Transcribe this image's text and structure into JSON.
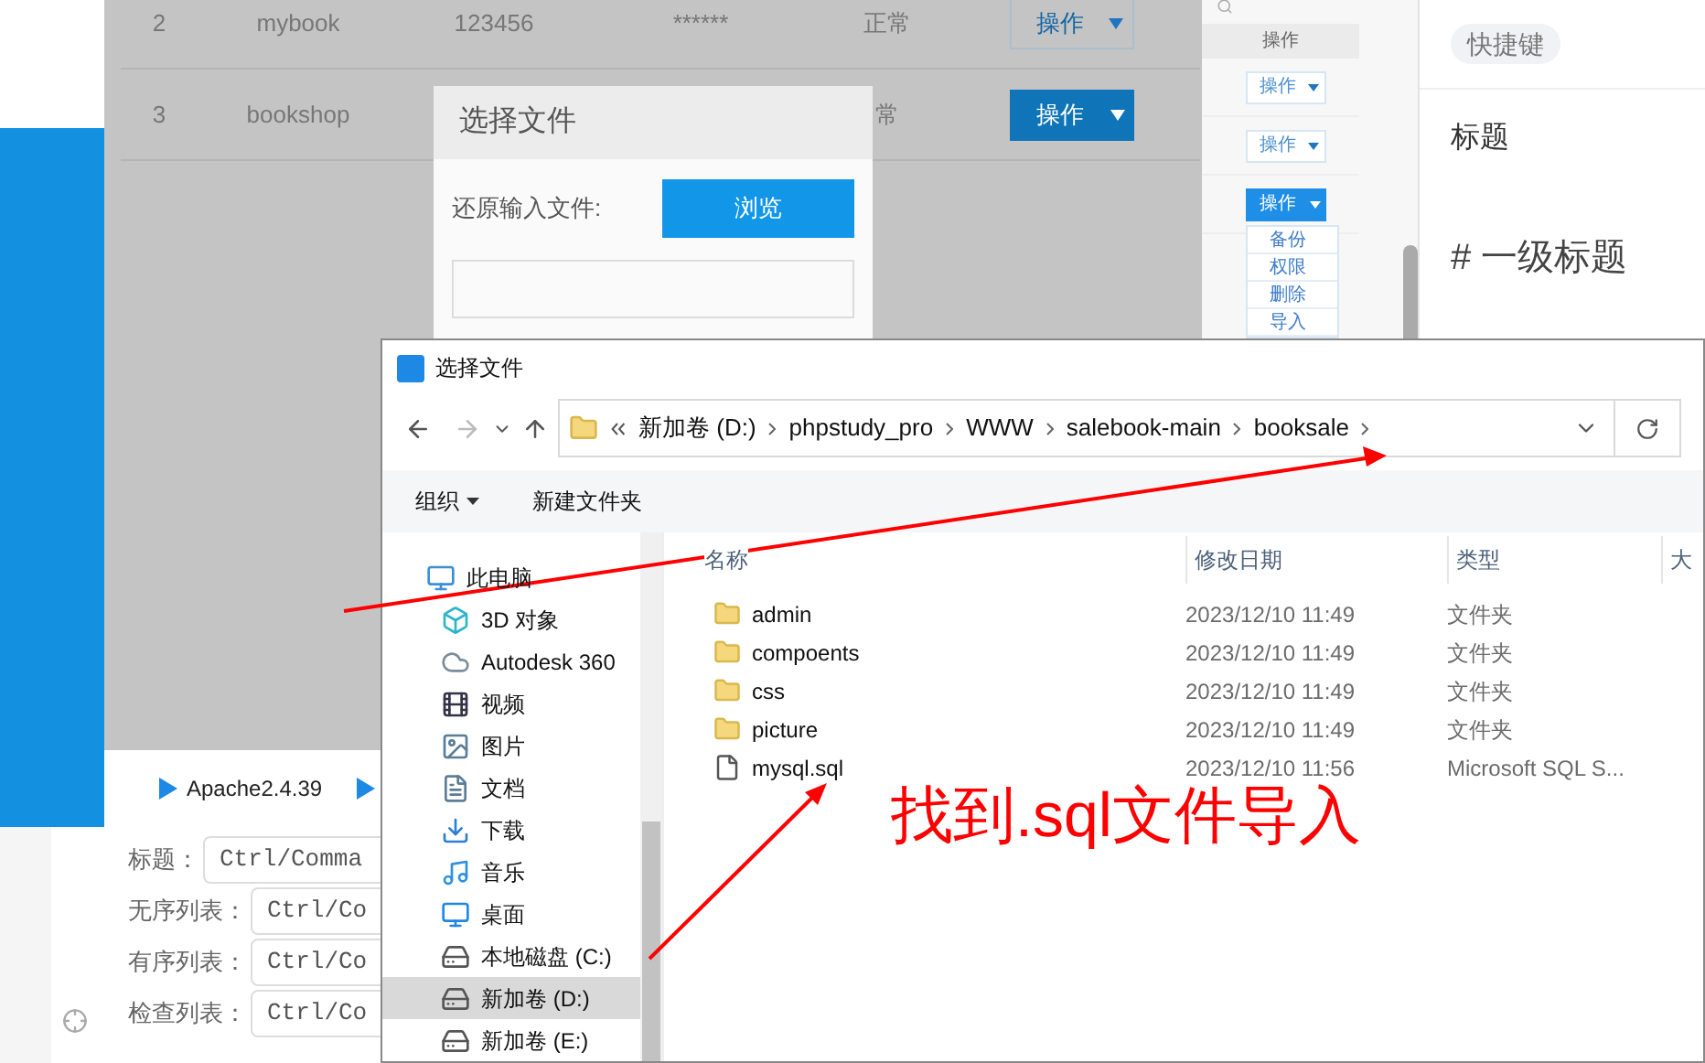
{
  "background_app": {
    "rows": [
      {
        "cells": [
          "2",
          "mybook",
          "123456",
          "******"
        ],
        "status": "正常",
        "action": "操作",
        "active": false
      },
      {
        "cells": [
          "3",
          "bookshop"
        ],
        "status": "常",
        "action": "操作",
        "active": true
      }
    ],
    "modal": {
      "title": "选择文件",
      "label": "还原输入文件:",
      "button": "浏览"
    }
  },
  "preview_strip": {
    "column_header": "操作",
    "buttons": [
      {
        "label": "操作",
        "active": false
      },
      {
        "label": "操作",
        "active": false
      },
      {
        "label": "操作",
        "active": true
      }
    ],
    "menu": [
      "备份",
      "权限",
      "删除",
      "导入"
    ]
  },
  "editor": {
    "badge": "快捷键",
    "heading": "标题",
    "example": "# 一级标题"
  },
  "server_bar": {
    "items": [
      "Apache2.4.39"
    ]
  },
  "shortcuts": [
    {
      "label": "标题：",
      "value": "Ctrl/Comma"
    },
    {
      "label": "无序列表：",
      "value": "Ctrl/Co"
    },
    {
      "label": "有序列表：",
      "value": "Ctrl/Co"
    },
    {
      "label": "检查列表：",
      "value": "Ctrl/Co"
    }
  ],
  "file_dialog": {
    "title": "选择文件",
    "path": [
      "新加卷 (D:)",
      "phpstudy_pro",
      "WWW",
      "salebook-main",
      "booksale"
    ],
    "organize": "组织",
    "new_folder": "新建文件夹",
    "nav": [
      {
        "label": "此电脑",
        "kind": "pc",
        "selected": false,
        "children": [
          {
            "label": "3D 对象",
            "kind": "cube",
            "selected": false
          },
          {
            "label": "Autodesk 360",
            "kind": "cloud",
            "selected": false
          },
          {
            "label": "视频",
            "kind": "film",
            "selected": false
          },
          {
            "label": "图片",
            "kind": "image",
            "selected": false
          },
          {
            "label": "文档",
            "kind": "doc",
            "selected": false
          },
          {
            "label": "下载",
            "kind": "download",
            "selected": false
          },
          {
            "label": "音乐",
            "kind": "music",
            "selected": false
          },
          {
            "label": "桌面",
            "kind": "desktop",
            "selected": false
          },
          {
            "label": "本地磁盘 (C:)",
            "kind": "drive",
            "selected": false
          },
          {
            "label": "新加卷 (D:)",
            "kind": "drive",
            "selected": true
          },
          {
            "label": "新加卷 (E:)",
            "kind": "drive",
            "selected": false
          }
        ]
      }
    ],
    "columns": [
      "名称",
      "修改日期",
      "类型",
      "大"
    ],
    "files": [
      {
        "name": "admin",
        "kind": "folder",
        "modified": "2023/12/10 11:49",
        "type": "文件夹"
      },
      {
        "name": "compoents",
        "kind": "folder",
        "modified": "2023/12/10 11:49",
        "type": "文件夹"
      },
      {
        "name": "css",
        "kind": "folder",
        "modified": "2023/12/10 11:49",
        "type": "文件夹"
      },
      {
        "name": "picture",
        "kind": "folder",
        "modified": "2023/12/10 11:49",
        "type": "文件夹"
      },
      {
        "name": "mysql.sql",
        "kind": "file",
        "modified": "2023/12/10 11:56",
        "type": "Microsoft SQL S..."
      }
    ]
  },
  "annotation": {
    "text": "找到.sql文件导入"
  }
}
